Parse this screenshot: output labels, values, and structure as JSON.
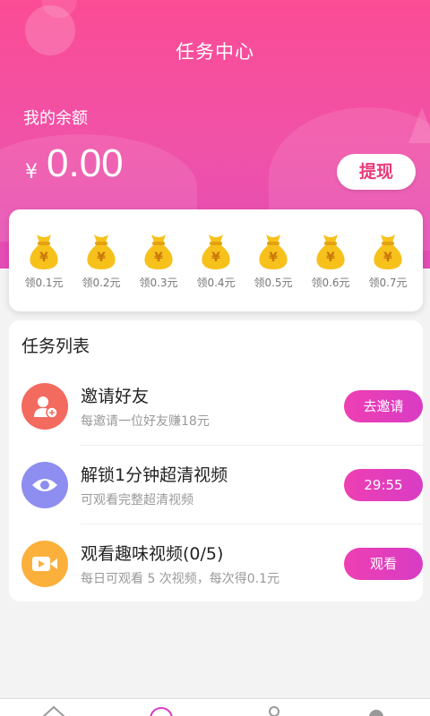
{
  "header": {
    "title": "任务中心",
    "balance_label": "我的余额",
    "currency": "¥",
    "balance": "0.00",
    "withdraw_label": "提现"
  },
  "rewards": [
    {
      "label": "领0.1元"
    },
    {
      "label": "领0.2元"
    },
    {
      "label": "领0.3元"
    },
    {
      "label": "领0.4元"
    },
    {
      "label": "领0.5元"
    },
    {
      "label": "领0.6元"
    },
    {
      "label": "领0.7元"
    }
  ],
  "reward_icon": "money-bag-icon",
  "reward_bag_symbol": "¥",
  "tasks": {
    "title": "任务列表",
    "items": [
      {
        "name": "邀请好友",
        "desc": "每邀请一位好友赚18元",
        "button": "去邀请",
        "icon": "add-user-icon",
        "color": "#f36a5f"
      },
      {
        "name": "解锁1分钟超清视频",
        "desc": "可观看完整超清视频",
        "button": "29:55",
        "icon": "eye-icon",
        "color": "#8e8ef0"
      },
      {
        "name": "观看趣味视频(0/5)",
        "desc": "每日可观看 5 次视频，每次得0.1元",
        "button": "观看",
        "icon": "video-icon",
        "color": "#fbb03b"
      }
    ]
  },
  "colors": {
    "header_top": "#fb4c95",
    "header_bottom": "#e24cb6",
    "button_gradient_start": "#ee3fb3",
    "button_gradient_end": "#d83cc4",
    "bag_gold": "#f7c11c"
  }
}
